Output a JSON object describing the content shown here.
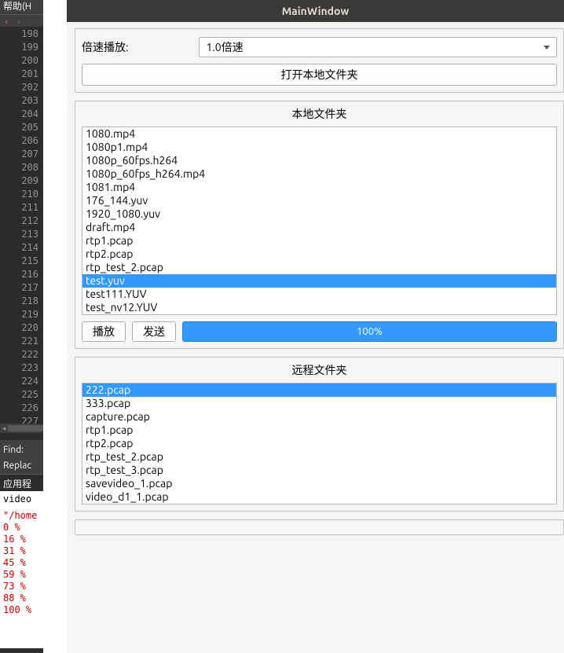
{
  "editor": {
    "menu_help": "帮助(H",
    "line_start": 198,
    "line_end": 227,
    "find_label": "Find:",
    "replace_label": "Replac",
    "app_output_header": "应用程",
    "output_title": "video",
    "output_path_fragment": "\"/home",
    "progress_lines": [
      "0 %",
      "16 %",
      "31 %",
      "45 %",
      "59 %",
      "73 %",
      "88 %",
      "100 %"
    ]
  },
  "mainwindow": {
    "title": "MainWindow",
    "speed": {
      "label": "倍速播放:",
      "value": "1.0倍速"
    },
    "open_local_btn": "打开本地文件夹",
    "local": {
      "title": "本地文件夹",
      "items": [
        "1080.mp4",
        "1080p1.mp4",
        "1080p_60fps.h264",
        "1080p_60fps_h264.mp4",
        "1081.mp4",
        "176_144.yuv",
        "1920_1080.yuv",
        "draft.mp4",
        "rtp1.pcap",
        "rtp2.pcap",
        "rtp_test_2.pcap",
        "test.yuv",
        "test111.YUV",
        "test_nv12.YUV"
      ],
      "selected_index": 11,
      "play_btn": "播放",
      "send_btn": "发送",
      "progress_text": "100%"
    },
    "remote": {
      "title": "远程文件夹",
      "items": [
        "222.pcap",
        "333.pcap",
        "capture.pcap",
        "rtp1.pcap",
        "rtp2.pcap",
        "rtp_test_2.pcap",
        "rtp_test_3.pcap",
        "savevideo_1.pcap",
        "video_d1_1.pcap"
      ],
      "selected_index": 0
    }
  }
}
